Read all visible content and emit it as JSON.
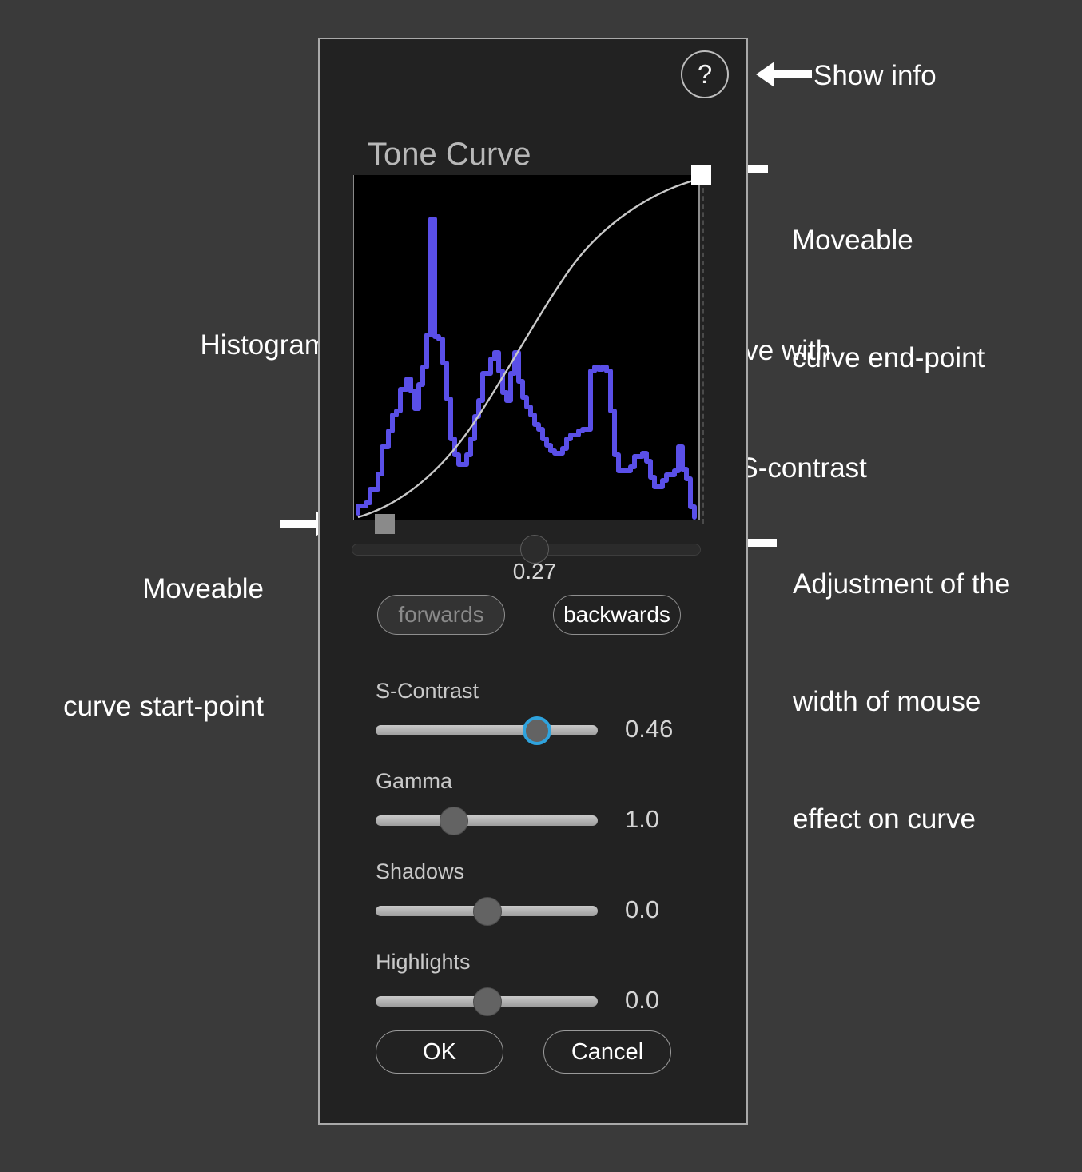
{
  "dialog": {
    "title": "Tone Curve",
    "help_icon": "?",
    "help_label": "?"
  },
  "plot": {
    "endpoint_handle_name": "curve-end-point",
    "startpoint_handle_name": "curve-start-point"
  },
  "width_slider": {
    "value": "0.27"
  },
  "direction": {
    "forwards": "forwards",
    "backwards": "backwards"
  },
  "params": [
    {
      "label": "S-Contrast",
      "value": "0.46",
      "thumb_pct": 68,
      "focused": true
    },
    {
      "label": "Gamma",
      "value": "1.0",
      "thumb_pct": 33,
      "focused": false
    },
    {
      "label": "Shadows",
      "value": "0.0",
      "thumb_pct": 48,
      "focused": false
    },
    {
      "label": "Highlights",
      "value": "0.0",
      "thumb_pct": 48,
      "focused": false
    }
  ],
  "actions": {
    "ok": "OK",
    "cancel": "Cancel"
  },
  "annotations": {
    "show_info": "Show info",
    "end_point_l1": "Moveable",
    "end_point_l2": "curve end-point",
    "tone_curve_l1": "Tone curve with",
    "tone_curve_l2": "positive S-contrast",
    "histogram": "Histogram",
    "start_point_l1": "Moveable",
    "start_point_l2": "curve start-point",
    "width_adj_l1": "Adjustment of the",
    "width_adj_l2": "width of mouse",
    "width_adj_l3": "effect on curve"
  },
  "colors": {
    "background": "#3a3a3a",
    "panel": "#222222",
    "panel_border": "#a9a9a9",
    "plot_background": "#000000",
    "histogram": "#5a4fe8",
    "tone_curve": "#c9c9c9",
    "accent_focus": "#2fa3dd",
    "annotation_text": "#ffffff",
    "label_text": "#c9c9c9"
  },
  "chart_data": {
    "type": "line",
    "title": "Tone Curve",
    "xlabel": "",
    "ylabel": "",
    "xlim": [
      0,
      255
    ],
    "ylim": [
      0,
      1
    ],
    "grid": false,
    "legend": "none",
    "series": [
      {
        "name": "Histogram",
        "color": "#5a4fe8",
        "x": [
          0,
          3,
          6,
          9,
          12,
          15,
          18,
          21,
          24,
          27,
          30,
          33,
          36,
          39,
          42,
          45,
          48,
          51,
          54,
          57,
          60,
          63,
          66,
          69,
          72,
          75,
          78,
          81,
          84,
          87,
          90,
          93,
          96,
          99,
          102,
          105,
          108,
          111,
          114,
          117,
          120,
          123,
          126,
          129,
          132,
          135,
          138,
          141,
          144,
          147,
          150,
          153,
          156,
          159,
          162,
          165,
          168,
          171,
          174,
          177,
          180,
          183,
          186,
          189,
          192,
          195,
          198,
          201,
          204,
          207,
          210,
          213,
          216,
          219,
          222,
          225,
          228,
          231,
          234,
          237,
          240,
          243,
          246,
          249,
          252,
          255
        ],
        "values": [
          0.02,
          0.04,
          0.04,
          0.09,
          0.09,
          0.22,
          0.22,
          0.27,
          0.27,
          0.28,
          0.33,
          0.4,
          0.4,
          0.46,
          0.41,
          0.41,
          0.46,
          0.5,
          0.57,
          0.57,
          0.62,
          0.62,
          0.97,
          0.97,
          0.62,
          0.62,
          0.57,
          0.48,
          0.48,
          0.38,
          0.3,
          0.28,
          0.28,
          0.3,
          0.3,
          0.33,
          0.37,
          0.4,
          0.49,
          0.49,
          0.54,
          0.54,
          0.56,
          0.5,
          0.43,
          0.43,
          0.43,
          0.54,
          0.54,
          0.44,
          0.4,
          0.4,
          0.36,
          0.33,
          0.3,
          0.28,
          0.26,
          0.26,
          0.25,
          0.28,
          0.29,
          0.29,
          0.31,
          0.31,
          0.32,
          0.35,
          0.36,
          0.54,
          0.54,
          0.53,
          0.54,
          0.54,
          0.37,
          0.2,
          0.18,
          0.18,
          0.19,
          0.24,
          0.24,
          0.22,
          0.18,
          0.15,
          0.16,
          0.19,
          0.31,
          0.1
        ]
      },
      {
        "name": "Tone curve with positive S-contrast",
        "color": "#c9c9c9",
        "x": [
          0,
          16,
          32,
          48,
          64,
          80,
          96,
          112,
          128,
          144,
          160,
          176,
          192,
          208,
          224,
          240,
          255
        ],
        "values": [
          0.0,
          0.02,
          0.05,
          0.09,
          0.14,
          0.21,
          0.3,
          0.4,
          0.51,
          0.62,
          0.72,
          0.8,
          0.87,
          0.92,
          0.96,
          0.99,
          1.0
        ]
      }
    ]
  }
}
